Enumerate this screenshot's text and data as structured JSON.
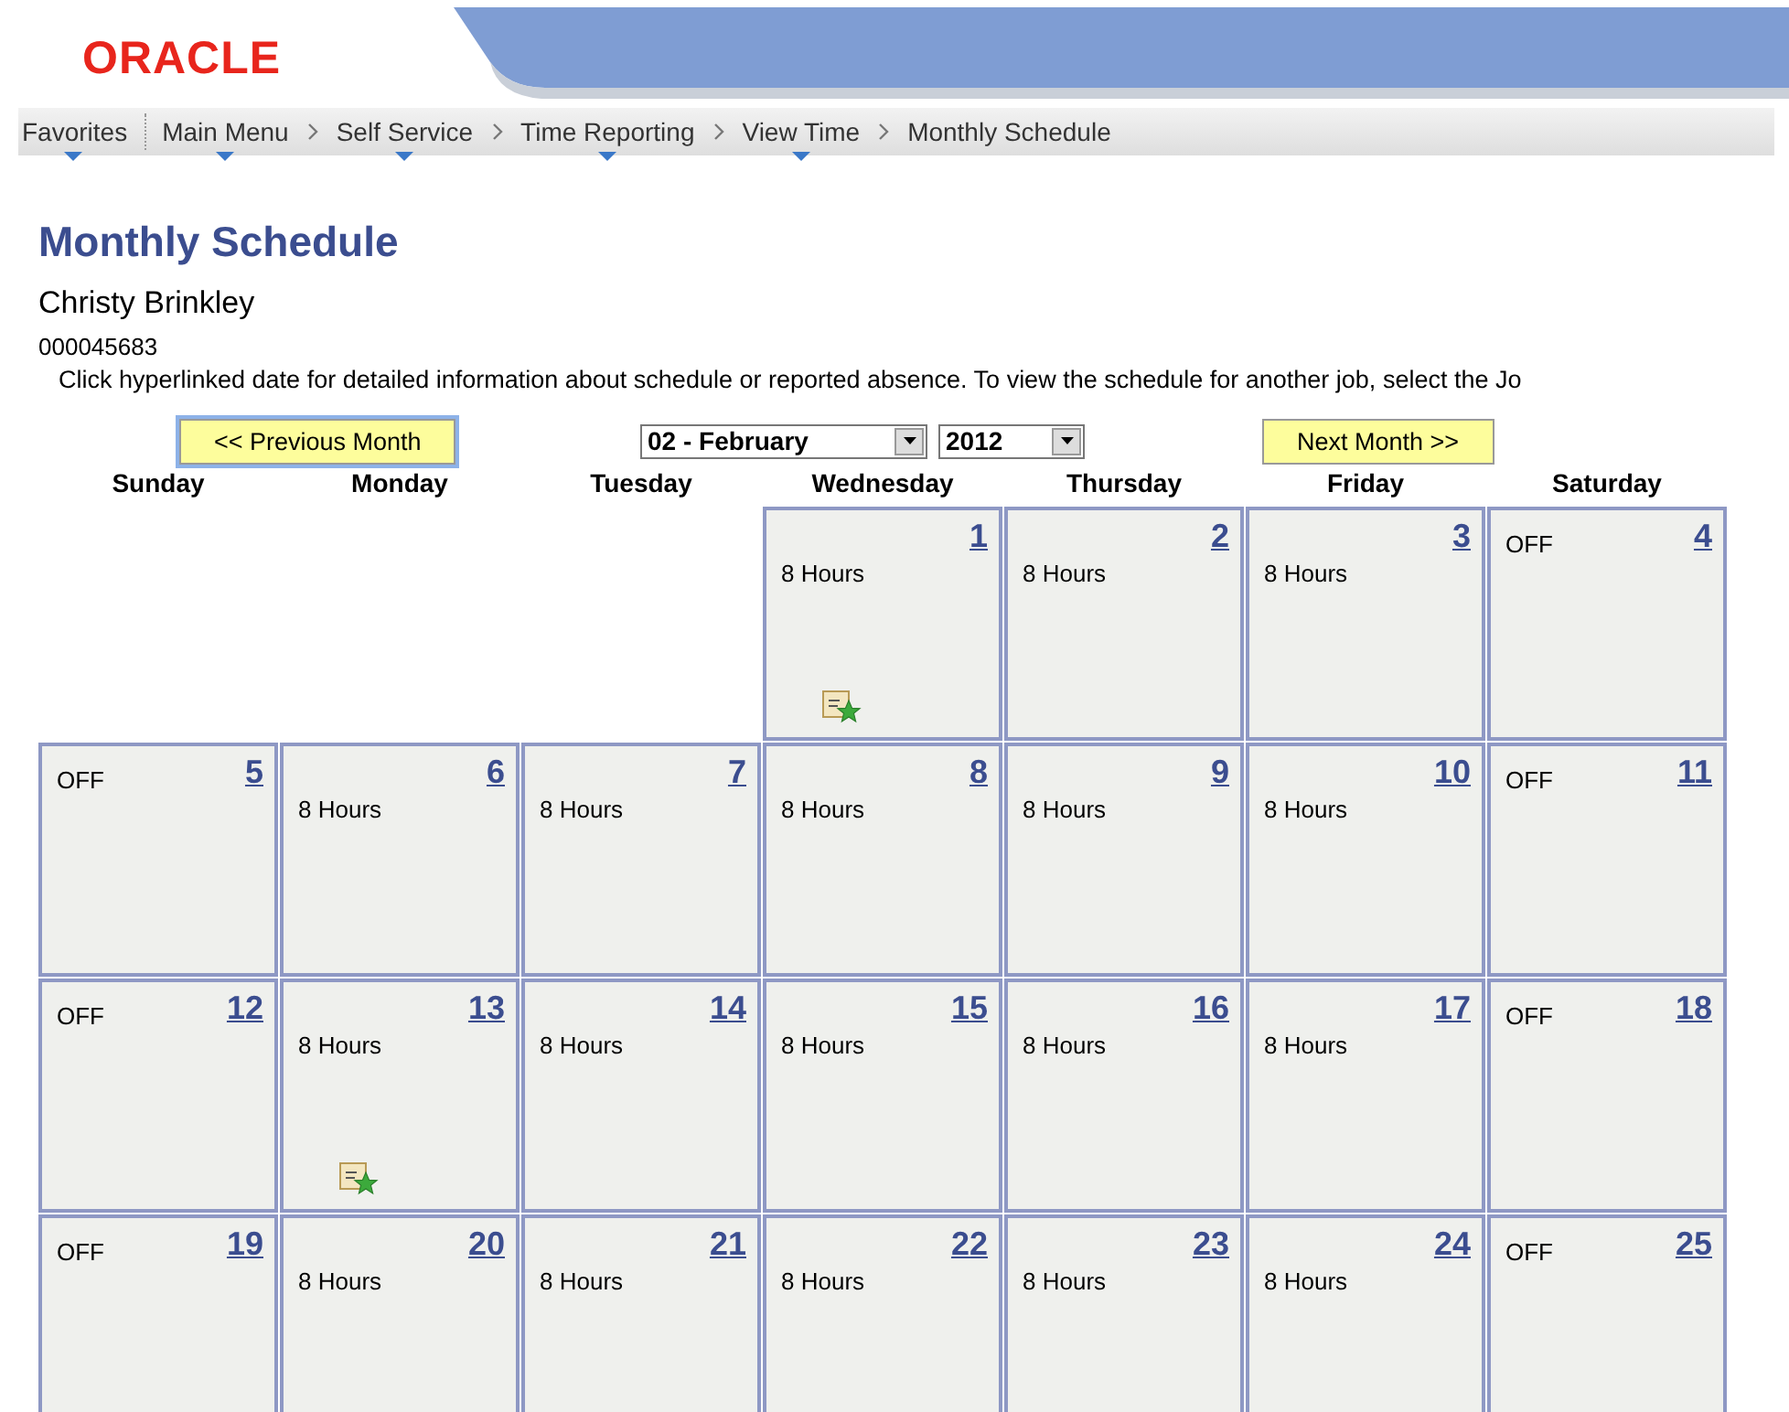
{
  "logo": "ORACLE",
  "breadcrumb": [
    {
      "label": "Favorites",
      "dropdown": true
    },
    {
      "label": "Main Menu",
      "dropdown": true
    },
    {
      "label": "Self Service",
      "dropdown": true
    },
    {
      "label": "Time Reporting",
      "dropdown": true
    },
    {
      "label": "View Time",
      "dropdown": true
    },
    {
      "label": "Monthly Schedule",
      "dropdown": false
    }
  ],
  "title": "Monthly Schedule",
  "employee_name": "Christy Brinkley",
  "employee_id": "000045683",
  "instructions": "Click hyperlinked date for detailed information about schedule or reported absence. To view the schedule for another job, select the Jo",
  "previous_button": "<< Previous Month",
  "next_button": "Next Month >>",
  "month_select": "02 - February",
  "year_select": "2012",
  "weekdays": [
    "Sunday",
    "Monday",
    "Tuesday",
    "Wednesday",
    "Thursday",
    "Friday",
    "Saturday"
  ],
  "weeks": [
    [
      {
        "kind": "blank"
      },
      {
        "kind": "blank"
      },
      {
        "kind": "blank"
      },
      {
        "kind": "work",
        "day": "1",
        "text": "8 Hours",
        "note": true
      },
      {
        "kind": "work",
        "day": "2",
        "text": "8 Hours",
        "note": false
      },
      {
        "kind": "work",
        "day": "3",
        "text": "8 Hours",
        "note": false
      },
      {
        "kind": "off",
        "day": "4",
        "text": "OFF",
        "note": false
      }
    ],
    [
      {
        "kind": "off",
        "day": "5",
        "text": "OFF",
        "note": false
      },
      {
        "kind": "work",
        "day": "6",
        "text": "8 Hours",
        "note": false
      },
      {
        "kind": "work",
        "day": "7",
        "text": "8 Hours",
        "note": false
      },
      {
        "kind": "work",
        "day": "8",
        "text": "8 Hours",
        "note": false
      },
      {
        "kind": "work",
        "day": "9",
        "text": "8 Hours",
        "note": false
      },
      {
        "kind": "work",
        "day": "10",
        "text": "8 Hours",
        "note": false
      },
      {
        "kind": "off",
        "day": "11",
        "text": "OFF",
        "note": false
      }
    ],
    [
      {
        "kind": "off",
        "day": "12",
        "text": "OFF",
        "note": false
      },
      {
        "kind": "work",
        "day": "13",
        "text": "8 Hours",
        "note": true
      },
      {
        "kind": "work",
        "day": "14",
        "text": "8 Hours",
        "note": false
      },
      {
        "kind": "work",
        "day": "15",
        "text": "8 Hours",
        "note": false
      },
      {
        "kind": "work",
        "day": "16",
        "text": "8 Hours",
        "note": false
      },
      {
        "kind": "work",
        "day": "17",
        "text": "8 Hours",
        "note": false
      },
      {
        "kind": "off",
        "day": "18",
        "text": "OFF",
        "note": false
      }
    ],
    [
      {
        "kind": "off",
        "day": "19",
        "text": "OFF",
        "note": false
      },
      {
        "kind": "work",
        "day": "20",
        "text": "8 Hours",
        "note": false
      },
      {
        "kind": "work",
        "day": "21",
        "text": "8 Hours",
        "note": false
      },
      {
        "kind": "work",
        "day": "22",
        "text": "8 Hours",
        "note": false
      },
      {
        "kind": "work",
        "day": "23",
        "text": "8 Hours",
        "note": false
      },
      {
        "kind": "work",
        "day": "24",
        "text": "8 Hours",
        "note": false
      },
      {
        "kind": "off",
        "day": "25",
        "text": "OFF",
        "note": false
      }
    ]
  ]
}
